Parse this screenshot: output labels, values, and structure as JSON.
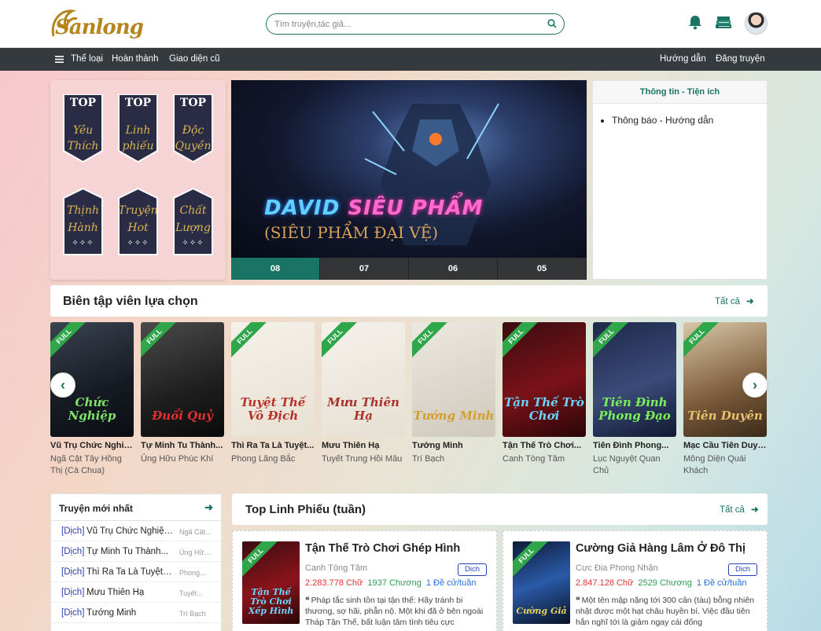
{
  "header": {
    "logo_text": "Sanlong",
    "search": {
      "placeholder": "Tìm truyện,tác giả..."
    }
  },
  "nav": {
    "left": [
      "Thể loại",
      "Hoàn thành",
      "Giao diện cũ"
    ],
    "right": [
      "Hướng dẫn",
      "Đăng truyện"
    ]
  },
  "promo": {
    "top_label": "TOP",
    "pennants": [
      {
        "l1": "Yêu",
        "l2": "Thích"
      },
      {
        "l1": "Linh",
        "l2": "phiếu"
      },
      {
        "l1": "Độc",
        "l2": "Quyền"
      },
      {
        "l1": "Thịnh",
        "l2": "Hành"
      },
      {
        "l1": "Truyện",
        "l2": "Hot"
      },
      {
        "l1": "Chất",
        "l2": "Lượng"
      }
    ],
    "stars": "✧✧✧"
  },
  "banner": {
    "title_a": "DAVID",
    "title_b": "SIÊU PHẨM",
    "subtitle": "(SIÊU PHẨM ĐẠI VỆ)",
    "slides": [
      "08",
      "07",
      "06",
      "05"
    ],
    "active_index": 0
  },
  "info": {
    "title": "Thông tin - Tiện ích",
    "items": [
      "Thông báo - Hướng dẫn"
    ]
  },
  "editors_pick": {
    "title": "Biên tập viên lựa chọn",
    "all_label": "Tất cả",
    "ribbon": "FULL",
    "cards": [
      {
        "name": "Vũ Trụ Chức Nghiệp...",
        "author": "Ngã Cật Tây Hồng Thị (Cà Chua)",
        "art": "Chức Nghiệp",
        "bg": "linear-gradient(160deg,#3a4350,#151a22 60%,#0b0d12)",
        "art_color": "#7ee36a"
      },
      {
        "name": "Tự Minh Tu Thành...",
        "author": "Ủng Hữu Phúc Khí",
        "art": "Đuổi Quỷ",
        "bg": "linear-gradient(160deg,#4b4b4b,#1e1e1e 60%,#0a0a0a)",
        "art_color": "#e23030"
      },
      {
        "name": "Thì Ra Ta Là Tuyệt...",
        "author": "Phong Lăng Bắc",
        "art": "Tuyệt Thế Vô Địch",
        "bg": "linear-gradient(160deg,#f4f1ea,#e8e1d3)",
        "art_color": "#b8322a"
      },
      {
        "name": "Mưu Thiên Hạ",
        "author": "Tuyết Trung Hồi Mâu",
        "art": "Mưu Thiên Hạ",
        "bg": "linear-gradient(160deg,#f5f2ec,#e6dfd2)",
        "art_color": "#a8332a"
      },
      {
        "name": "Tướng Minh",
        "author": "Trí Bạch",
        "art": "Tướng Minh",
        "bg": "linear-gradient(160deg,#ece9e2,#cfc8bb)",
        "art_color": "#d4a02a"
      },
      {
        "name": "Tận Thế Trò Chơi...",
        "author": "Canh Tòng Tâm",
        "art": "Tận Thế Trò Chơi",
        "bg": "linear-gradient(160deg,#3b0d10,#7a1218 55%,#2a0608)",
        "art_color": "#6ad4ff"
      },
      {
        "name": "Tiên Đình Phong...",
        "author": "Lục Nguyệt Quan Chủ",
        "art": "Tiên Đình Phong Đạo",
        "bg": "linear-gradient(160deg,#1d2a48,#3a4a7a 55%,#121a30)",
        "art_color": "#7cf05a"
      },
      {
        "name": "Mạc Cầu Tiên Duyên",
        "author": "Mông Diện Quái Khách",
        "art": "Tiên Duyên",
        "bg": "linear-gradient(160deg,#d9c7a8,#7a5a3a 60%,#3a2a1a)",
        "art_color": "#e8c36a"
      }
    ]
  },
  "new_stories": {
    "title": "Truyện mới nhất",
    "tag": "[Dịch]",
    "items": [
      {
        "title": "Vũ Trụ Chức Nghiệp...",
        "author": "Ngã Cật..."
      },
      {
        "title": "Tự Minh Tu Thành...",
        "author": "Ủng Hữu..."
      },
      {
        "title": "Thì Ra Ta Là Tuyệt T...",
        "author": "Phong..."
      },
      {
        "title": "Mưu Thiên Hạ",
        "author": "Tuyết..."
      },
      {
        "title": "Tướng Minh",
        "author": "Trí Bạch"
      }
    ]
  },
  "top_votes": {
    "title": "Top Linh Phiếu (tuần)",
    "all_label": "Tất cả",
    "books": [
      {
        "title": "Tận Thế Trò Chơi Ghép Hình",
        "author": "Canh Tòng Tâm",
        "tag": "Dịch",
        "words": "2.283.778 Chữ",
        "chapters": "1937 Chương",
        "nominations": "1 Đề cử/tuần",
        "desc": "Pháp tắc sinh tồn tại tận thế: Hãy tránh bi thương, sợ hãi, phẫn nộ. Một khi đã ở bên ngoài Tháp Tận Thế, bất luận tâm tình tiêu cực",
        "cover_art": "Tận Thế Trò Chơi Xếp Hình",
        "cover_bg": "linear-gradient(160deg,#3b0d10,#8a141b 55%,#2a0608)",
        "cover_color": "#6ad4ff"
      },
      {
        "title": "Cường Giả Hàng Lâm Ở Đô Thị",
        "author": "Cực Địa Phong Nhận",
        "tag": "Dịch",
        "words": "2.847.128 Chữ",
        "chapters": "2529 Chương",
        "nominations": "1 Đề cử/tuần",
        "desc": "Một tên mập nặng tới 300 cân (tàu) bỗng nhiên nhặt được một hạt châu huyền bí. Việc đầu tiên hắn nghĩ tới là giảm ngay cái đống",
        "cover_art": "Cường Giả",
        "cover_bg": "linear-gradient(160deg,#0e1a35,#2a5aa8 50%,#0a1224)",
        "cover_color": "#e6d35a"
      }
    ]
  },
  "colors": {
    "accent": "#1a7466",
    "nav_bg": "#353a3f",
    "ribbon": "#2fa64a",
    "link_blue": "#2a3fb5"
  }
}
